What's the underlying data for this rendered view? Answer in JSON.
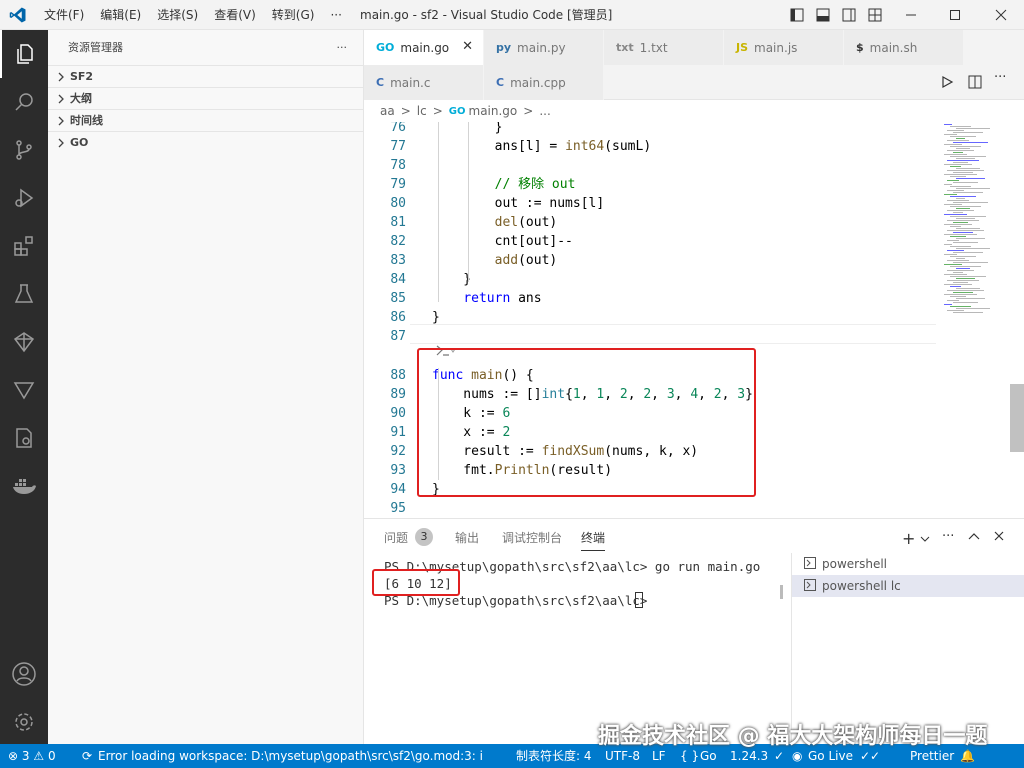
{
  "titlebar": {
    "menus": [
      "文件(F)",
      "编辑(E)",
      "选择(S)",
      "查看(V)",
      "转到(G)",
      "···"
    ],
    "title": "main.go - sf2 - Visual Studio Code [管理员]"
  },
  "sidebar": {
    "header": "资源管理器",
    "more": "···",
    "sections": [
      "SF2",
      "大纲",
      "时间线",
      "GO"
    ]
  },
  "tabs_row1": [
    {
      "label": "main.go",
      "icon": "GO",
      "active": true
    },
    {
      "label": "main.py",
      "icon": "py"
    },
    {
      "label": "1.txt",
      "icon": "txt"
    },
    {
      "label": "main.js",
      "icon": "JS"
    },
    {
      "label": "main.sh",
      "icon": "$"
    }
  ],
  "tabs_row2": [
    {
      "label": "main.c",
      "icon": "C"
    },
    {
      "label": "main.cpp",
      "icon": "C"
    }
  ],
  "breadcrumb": [
    "aa",
    ">",
    "lc",
    ">",
    "main.go",
    ">",
    "..."
  ],
  "editor": {
    "lines": [
      {
        "n": "76",
        "html": "<span>        }</span>"
      },
      {
        "n": "77",
        "html": "        ans[l] = <span class='fn'>int64</span>(sumL)"
      },
      {
        "n": "78",
        "html": ""
      },
      {
        "n": "79",
        "html": "        <span class='cm'>// 移除 out</span>"
      },
      {
        "n": "80",
        "html": "        out := nums[l]"
      },
      {
        "n": "81",
        "html": "        <span class='fn'>del</span>(out)"
      },
      {
        "n": "82",
        "html": "        cnt[out]--"
      },
      {
        "n": "83",
        "html": "        <span class='fn'>add</span>(out)"
      },
      {
        "n": "84",
        "html": "    }"
      },
      {
        "n": "85",
        "html": "    <span class='kw'>return</span> ans"
      },
      {
        "n": "86",
        "html": "}"
      },
      {
        "n": "87",
        "html": ""
      },
      {
        "n": "88",
        "html": "<span class='kw'>func</span> <span class='fn'>main</span>() {"
      },
      {
        "n": "89",
        "html": "    nums := []<span class='ty'>int</span>{<span class='num'>1</span>, <span class='num'>1</span>, <span class='num'>2</span>, <span class='num'>2</span>, <span class='num'>3</span>, <span class='num'>4</span>, <span class='num'>2</span>, <span class='num'>3</span>}"
      },
      {
        "n": "90",
        "html": "    k := <span class='num'>6</span>"
      },
      {
        "n": "91",
        "html": "    x := <span class='num'>2</span>"
      },
      {
        "n": "92",
        "html": "    result := <span class='fn'>findXSum</span>(nums, k, x)"
      },
      {
        "n": "93",
        "html": "    fmt.<span class='fn'>Println</span>(result)"
      },
      {
        "n": "94",
        "html": "}"
      },
      {
        "n": "95",
        "html": ""
      }
    ]
  },
  "panel": {
    "tabs": [
      "问题",
      "输出",
      "调试控制台",
      "终端"
    ],
    "problems_count": "3",
    "terminal_lines": [
      "PS D:\\mysetup\\gopath\\src\\sf2\\aa\\lc> go run main.go",
      "[6 10 12]",
      "PS D:\\mysetup\\gopath\\src\\sf2\\aa\\lc> "
    ],
    "terminals": [
      "powershell",
      "powershell  lc"
    ]
  },
  "statusbar": {
    "errors": "3",
    "warnings": "0",
    "message": "Error loading workspace: D:\\mysetup\\gopath\\src\\sf2\\go.mod:3: invalid g",
    "indent": "制表符长度: 4",
    "encoding": "UTF-8",
    "eol": "LF",
    "language": "Go",
    "version": "1.24.3",
    "golive": "Go Live",
    "prettier": "Prettier"
  },
  "watermark": "掘金技术社区 @ 福大大架构师每日一题",
  "colors": {
    "accent": "#007acc",
    "highlight_box": "#e02020"
  }
}
